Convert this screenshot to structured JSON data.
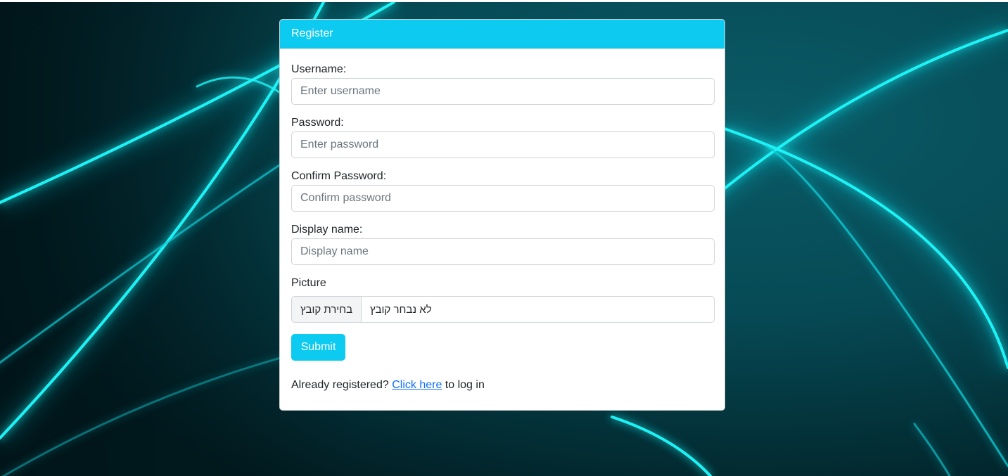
{
  "form": {
    "header_title": "Register",
    "username": {
      "label": "Username:",
      "placeholder": "Enter username"
    },
    "password": {
      "label": "Password:",
      "placeholder": "Enter password"
    },
    "confirm_password": {
      "label": "Confirm Password:",
      "placeholder": "Confirm password"
    },
    "display_name": {
      "label": "Display name:",
      "placeholder": "Display name"
    },
    "picture": {
      "label": "Picture",
      "choose_file_label": "בחירת קובץ",
      "no_file_text": "לא נבחר קובץ"
    },
    "submit_label": "Submit",
    "footer": {
      "prefix": "Already registered?",
      "link_text": "Click here",
      "suffix": "to log in"
    }
  },
  "colors": {
    "accent": "#0dcaf0",
    "link": "#0d6efd",
    "background_dark": "#00262c",
    "background_glow": "#19f0f5"
  }
}
